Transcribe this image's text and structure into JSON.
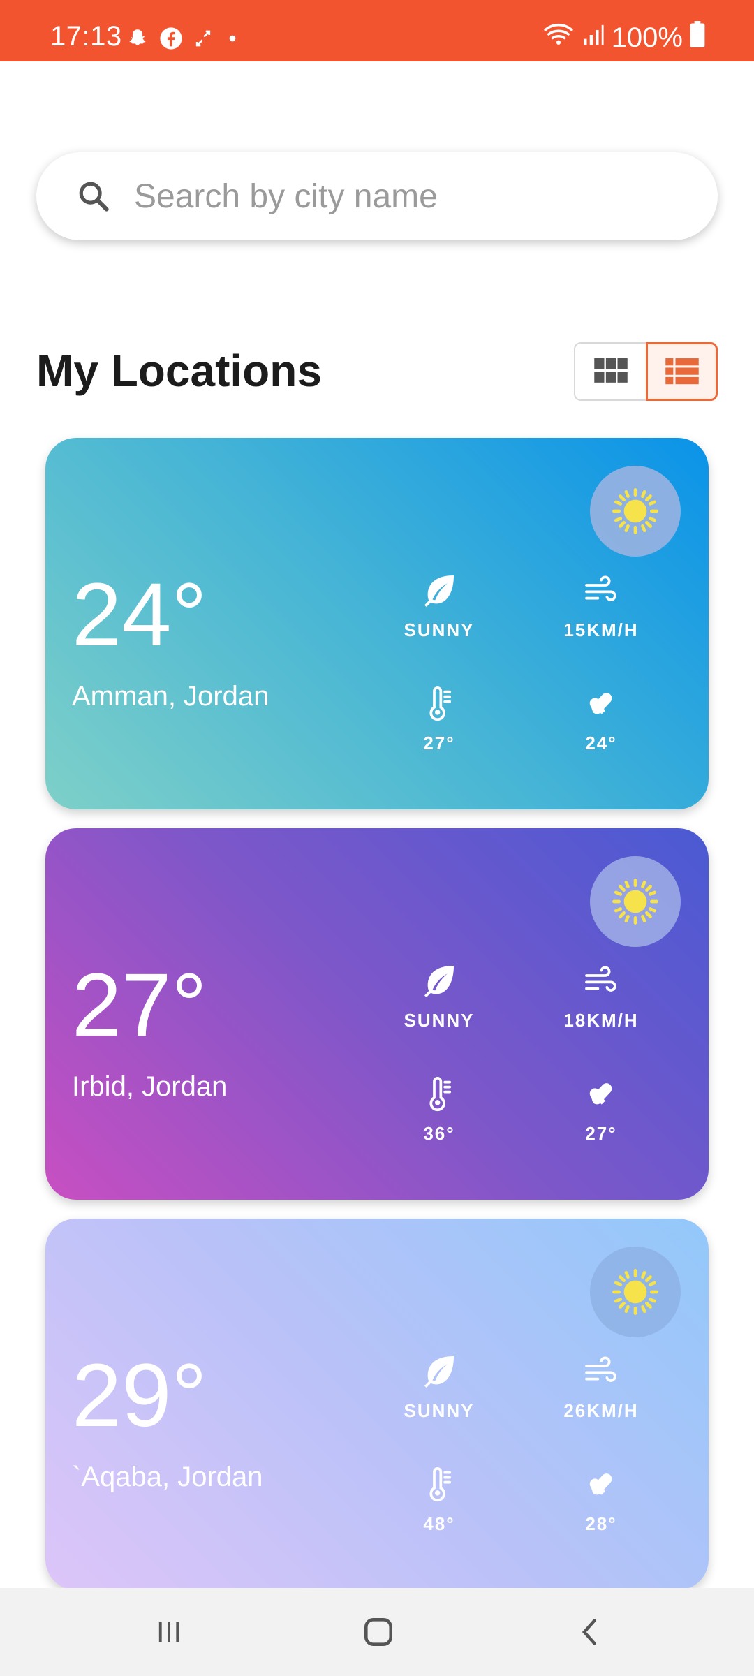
{
  "status_bar": {
    "time": "17:13",
    "battery": "100%",
    "left_icons": [
      "snapchat-icon",
      "facebook-icon",
      "sync-icon",
      "dot-icon"
    ],
    "right_icons": [
      "wifi-icon",
      "signal-icon",
      "battery-icon"
    ],
    "color": "#F35430"
  },
  "search": {
    "placeholder": "Search by city name",
    "value": ""
  },
  "section": {
    "title": "My Locations",
    "view_modes": [
      "grid",
      "list"
    ],
    "selected_view": "list",
    "accent": "#E86A3A"
  },
  "locations": [
    {
      "temperature": "24°",
      "city": "Amman, Jordan",
      "condition": "SUNNY",
      "wind": "15KM/H",
      "max_temp": "27°",
      "min_temp": "24°",
      "icon": "sun-icon"
    },
    {
      "temperature": "27°",
      "city": "Irbid, Jordan",
      "condition": "SUNNY",
      "wind": "18KM/H",
      "max_temp": "36°",
      "min_temp": "27°",
      "icon": "sun-icon"
    },
    {
      "temperature": "29°",
      "city": "`Aqaba, Jordan",
      "condition": "SUNNY",
      "wind": "26KM/H",
      "max_temp": "48°",
      "min_temp": "28°",
      "icon": "sun-icon"
    }
  ],
  "nav_bar": {
    "buttons": [
      "recents-icon",
      "home-icon",
      "back-icon"
    ]
  }
}
